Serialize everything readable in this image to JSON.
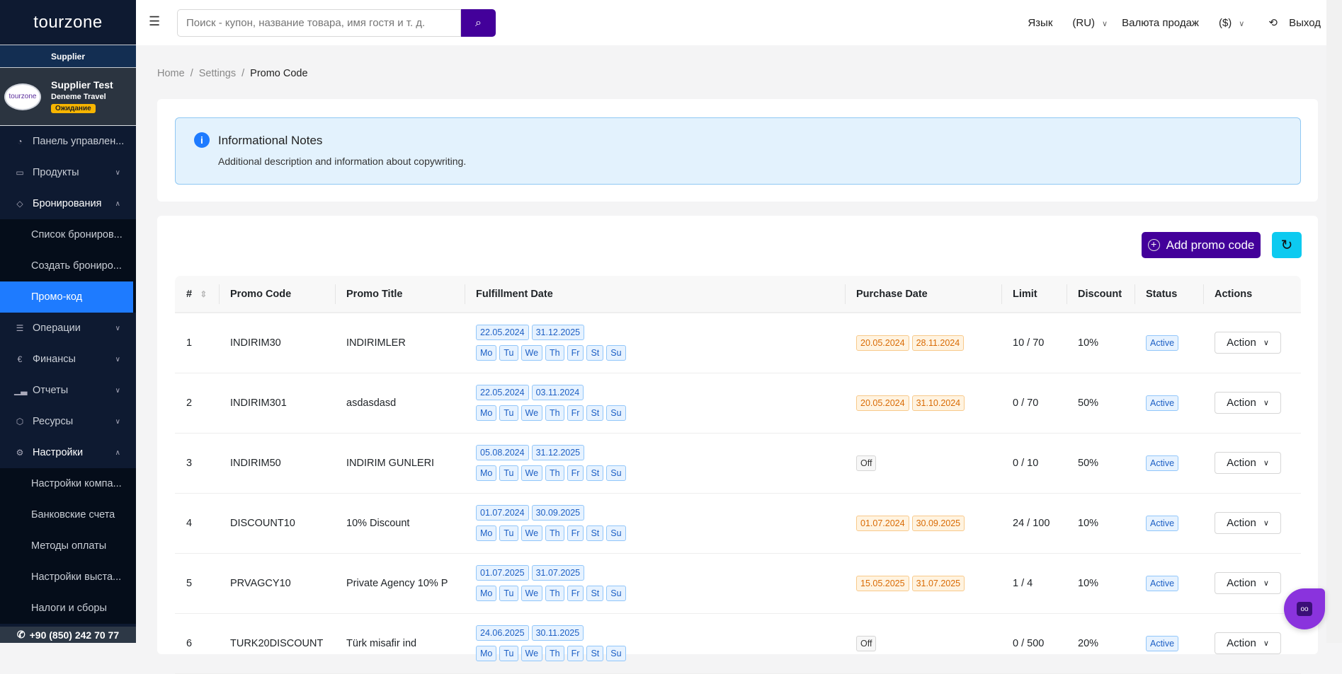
{
  "sidebar": {
    "logo": "tourzone",
    "role": "Supplier",
    "profile": {
      "logo": "tourzone",
      "name": "Supplier Test",
      "company": "Deneme Travel",
      "status": "Ожидание"
    },
    "items": [
      {
        "label": "Панель управлен...",
        "icon": "dashboard-icon",
        "glyph": "◔"
      },
      {
        "label": "Продукты",
        "icon": "bag-icon",
        "glyph": "▭",
        "chev": "⌄"
      },
      {
        "label": "Бронирования",
        "icon": "ticket-icon",
        "glyph": "◇",
        "chev": "⌃"
      },
      {
        "label": "Операции",
        "icon": "list-icon",
        "glyph": "☰",
        "chev": "⌄"
      },
      {
        "label": "Финансы",
        "icon": "euro-icon",
        "glyph": "€",
        "chev": "⌄"
      },
      {
        "label": "Отчеты",
        "icon": "chart-icon",
        "glyph": "▁▃",
        "chev": "⌄"
      },
      {
        "label": "Ресурсы",
        "icon": "cube-icon",
        "glyph": "⬡",
        "chev": "⌄"
      },
      {
        "label": "Настройки",
        "icon": "gear-icon",
        "glyph": "⚙",
        "chev": "⌃"
      }
    ],
    "booking_sub": [
      "Список брониров...",
      "Создать брониро...",
      "Промо-код"
    ],
    "settings_sub": [
      "Настройки компа...",
      "Банковские счета",
      "Методы оплаты",
      "Настройки выста...",
      "Налоги и сборы"
    ],
    "phone": "+90 (850) 242 70 77"
  },
  "topbar": {
    "search_placeholder": "Поиск - купон, название товара, имя гостя и т. д.",
    "language_label": "Язык",
    "language_value": "(RU)",
    "currency_label": "Валюта продаж",
    "currency_value": "($)",
    "logout": "Выход"
  },
  "breadcrumb": [
    "Home",
    "Settings",
    "Promo Code"
  ],
  "info": {
    "title": "Informational Notes",
    "description": "Additional description and information about copywriting."
  },
  "actions": {
    "add": "Add promo code"
  },
  "table": {
    "headers": [
      "#",
      "Promo Code",
      "Promo Title",
      "Fulfillment Date",
      "Purchase Date",
      "Limit",
      "Discount",
      "Status",
      "Actions"
    ],
    "days": [
      "Mo",
      "Tu",
      "We",
      "Th",
      "Fr",
      "St",
      "Su"
    ],
    "action_label": "Action",
    "rows": [
      {
        "n": "1",
        "code": "INDIRIM30",
        "title": "INDIRIMLER",
        "ful": [
          "22.05.2024",
          "31.12.2025"
        ],
        "pur": [
          "20.05.2024",
          "28.11.2024"
        ],
        "limit": "10 / 70",
        "discount": "10%",
        "status": "Active"
      },
      {
        "n": "2",
        "code": "INDIRIM301",
        "title": "asdasdasd",
        "ful": [
          "22.05.2024",
          "03.11.2024"
        ],
        "pur": [
          "20.05.2024",
          "31.10.2024"
        ],
        "limit": "0 / 70",
        "discount": "50%",
        "status": "Active"
      },
      {
        "n": "3",
        "code": "INDIRIM50",
        "title": "INDIRIM GUNLERI",
        "ful": [
          "05.08.2024",
          "31.12.2025"
        ],
        "pur": "Off",
        "limit": "0 / 10",
        "discount": "50%",
        "status": "Active"
      },
      {
        "n": "4",
        "code": "DISCOUNT10",
        "title": "10% Discount",
        "ful": [
          "01.07.2024",
          "30.09.2025"
        ],
        "pur": [
          "01.07.2024",
          "30.09.2025"
        ],
        "limit": "24 / 100",
        "discount": "10%",
        "status": "Active"
      },
      {
        "n": "5",
        "code": "PRVAGCY10",
        "title": "Private Agency 10% P",
        "ful": [
          "01.07.2025",
          "31.07.2025"
        ],
        "pur": [
          "15.05.2025",
          "31.07.2025"
        ],
        "limit": "1 / 4",
        "discount": "10%",
        "status": "Active"
      },
      {
        "n": "6",
        "code": "TURK20DISCOUNT",
        "title": "Türk misafir ind",
        "ful": [
          "24.06.2025",
          "30.11.2025"
        ],
        "pur": "Off",
        "limit": "0 / 500",
        "discount": "20%",
        "status": "Active"
      }
    ]
  }
}
